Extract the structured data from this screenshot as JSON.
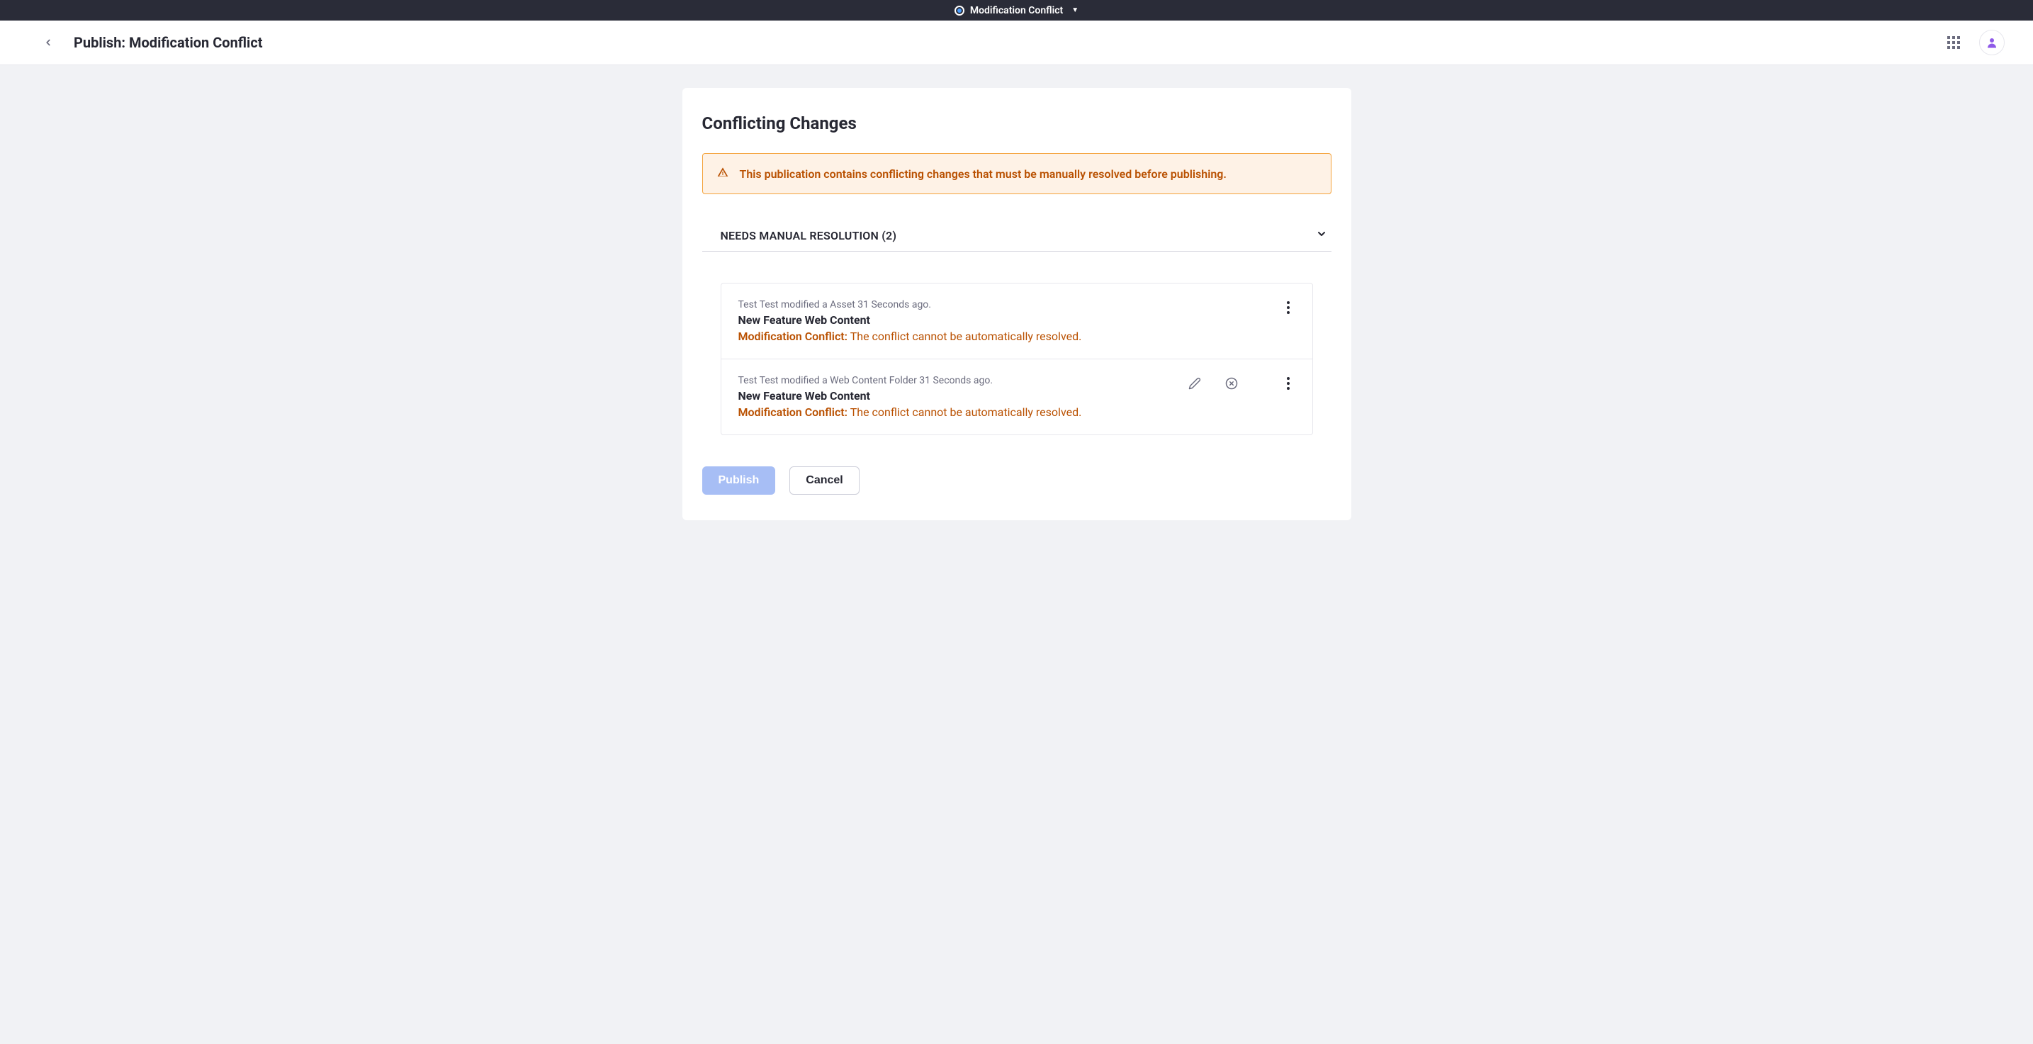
{
  "topbar": {
    "title": "Modification Conflict"
  },
  "header": {
    "page_title": "Publish: Modification Conflict"
  },
  "card": {
    "title": "Conflicting Changes",
    "alert_text": "This publication contains conflicting changes that must be manually resolved before publishing.",
    "section_title": "NEEDS MANUAL RESOLUTION (2)"
  },
  "conflicts": [
    {
      "meta": "Test Test modified a Asset 31 Seconds ago.",
      "title": "New Feature Web Content",
      "label": "Modification Conflict:",
      "detail": " The conflict cannot be automatically resolved.",
      "show_edit": false,
      "show_dismiss": false
    },
    {
      "meta": "Test Test modified a Web Content Folder 31 Seconds ago.",
      "title": "New Feature Web Content",
      "label": "Modification Conflict:",
      "detail": " The conflict cannot be automatically resolved.",
      "show_edit": true,
      "show_dismiss": true
    }
  ],
  "actions": {
    "publish": "Publish",
    "cancel": "Cancel"
  }
}
